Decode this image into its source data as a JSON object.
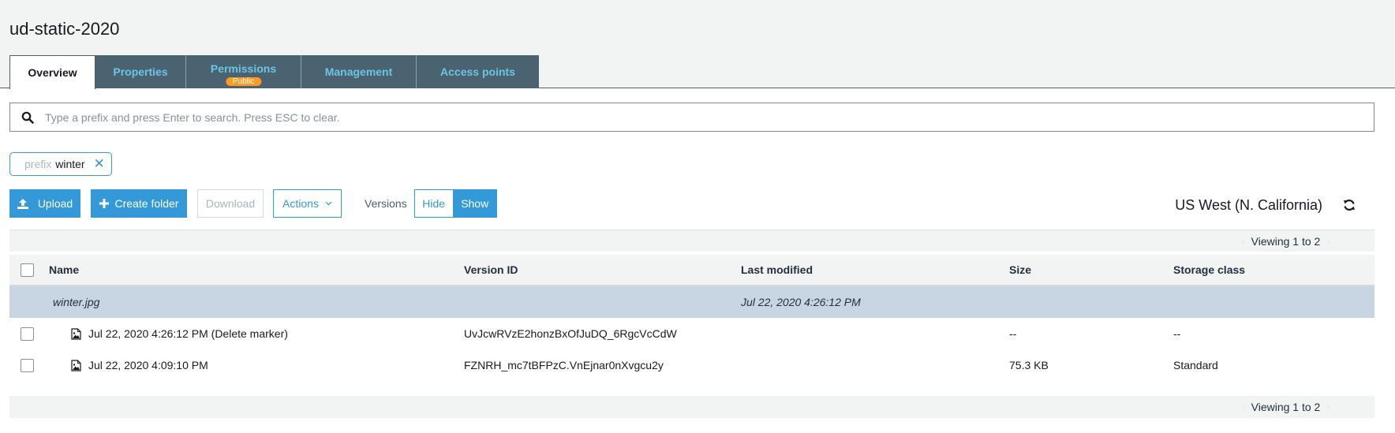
{
  "header": {
    "title": "ud-static-2020",
    "tabs": [
      {
        "label": "Overview",
        "active": true
      },
      {
        "label": "Properties"
      },
      {
        "label": "Permissions",
        "badge": "Public"
      },
      {
        "label": "Management"
      },
      {
        "label": "Access points"
      }
    ]
  },
  "search": {
    "placeholder": "Type a prefix and press Enter to search. Press ESC to clear.",
    "value": ""
  },
  "filter_chip": {
    "key": "prefix",
    "value": "winter"
  },
  "toolbar": {
    "upload_label": "Upload",
    "create_folder_label": "Create folder",
    "download_label": "Download",
    "actions_label": "Actions",
    "versions_label": "Versions",
    "hide_label": "Hide",
    "show_label": "Show"
  },
  "region": "US West (N. California)",
  "pager": {
    "text": "Viewing 1 to 2"
  },
  "table": {
    "columns": [
      "Name",
      "Version ID",
      "Last modified",
      "Size",
      "Storage class"
    ],
    "group": {
      "name": "winter.jpg",
      "last_modified": "Jul 22, 2020 4:26:12 PM"
    },
    "rows": [
      {
        "name": "Jul 22, 2020 4:26:12 PM (Delete marker)",
        "version_id": "UvJcwRVzE2honzBxOfJuDQ_6RgcVcCdW",
        "last_modified": "",
        "size": "--",
        "storage_class": "--"
      },
      {
        "name": "Jul 22, 2020 4:09:10 PM",
        "version_id": "FZNRH_mc7tBFPzC.VnEjnar0nXvgcu2y",
        "last_modified": "",
        "size": "75.3 KB",
        "storage_class": "Standard"
      }
    ]
  },
  "colors": {
    "accent": "#3499d8",
    "tab_bg": "#4b6271",
    "tab_text": "#6cc5e6",
    "badge": "#f89c24",
    "group_row": "#c8d6e3"
  }
}
